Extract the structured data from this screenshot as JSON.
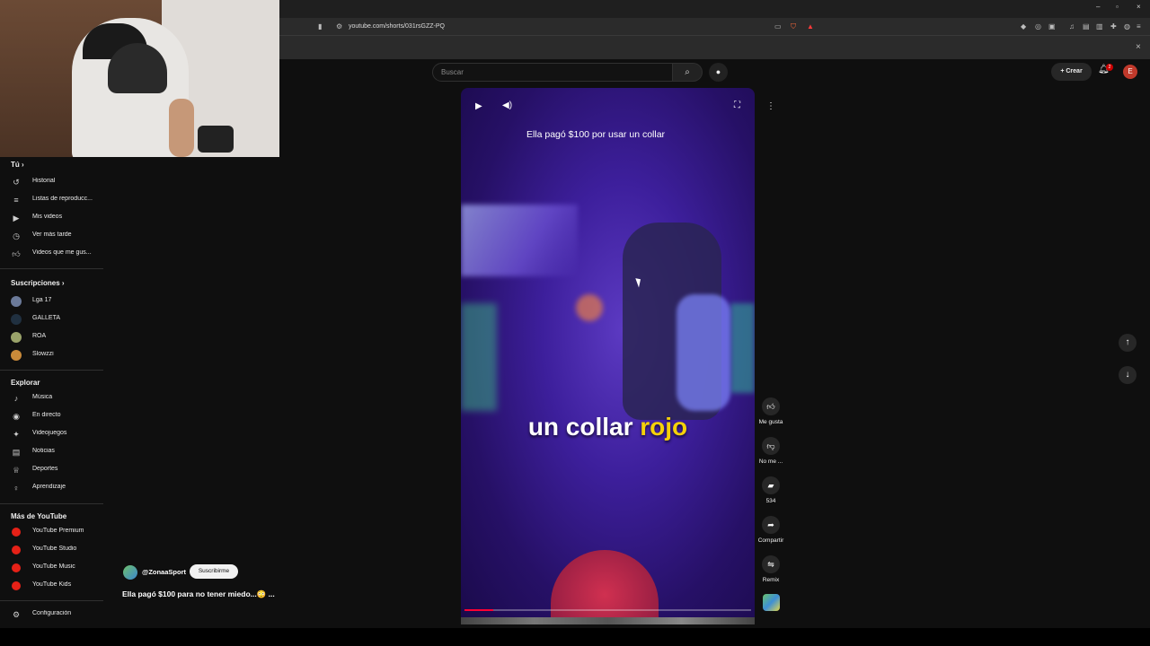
{
  "browser": {
    "url": "youtube.com/shorts/031rsGZZ-PQ",
    "close_panel": "×",
    "win_min": "–",
    "win_max": "▫",
    "win_close": "×"
  },
  "header": {
    "search_placeholder": "Buscar",
    "create_label": "Crear",
    "notif_count": "2",
    "avatar_letter": "E"
  },
  "sidebar": {
    "you": {
      "title": "Tú",
      "items": [
        {
          "label": "Historial",
          "icon": "history-icon"
        },
        {
          "label": "Listas de reproducc...",
          "icon": "playlist-icon"
        },
        {
          "label": "Mis videos",
          "icon": "my-videos-icon"
        },
        {
          "label": "Ver más tarde",
          "icon": "watch-later-icon"
        },
        {
          "label": "Videos que me gus...",
          "icon": "liked-videos-icon"
        }
      ]
    },
    "subs": {
      "title": "Suscripciones",
      "items": [
        {
          "label": "Lga 17",
          "color": "#6b7a99"
        },
        {
          "label": "GALLETA",
          "color": "#203040"
        },
        {
          "label": "ROA",
          "color": "#9aa36a"
        },
        {
          "label": "Slowzzi",
          "color": "#c98a3a"
        }
      ]
    },
    "explore": {
      "title": "Explorar",
      "items": [
        {
          "label": "Música",
          "icon": "music-icon"
        },
        {
          "label": "En directo",
          "icon": "live-icon"
        },
        {
          "label": "Videojuegos",
          "icon": "gaming-icon"
        },
        {
          "label": "Noticias",
          "icon": "news-icon"
        },
        {
          "label": "Deportes",
          "icon": "sports-icon"
        },
        {
          "label": "Aprendizaje",
          "icon": "learning-icon"
        }
      ]
    },
    "more": {
      "title": "Más de YouTube",
      "items": [
        {
          "label": "YouTube Premium"
        },
        {
          "label": "YouTube Studio"
        },
        {
          "label": "YouTube Music"
        },
        {
          "label": "YouTube Kids"
        }
      ]
    },
    "settings": "Configuración"
  },
  "short": {
    "overlay_title": "Ella pagó $100 por usar un collar",
    "caption_white": "un collar ",
    "caption_yellow": "rojo",
    "progress": 0.1,
    "channel": "@ZonaaSport",
    "subscribe": "Suscribirme",
    "description": "Ella pagó $100 para no tener miedo...😳 ..."
  },
  "actions": {
    "like": "Me gusta",
    "dislike": "No me ...",
    "comments": "534",
    "share": "Compartir",
    "remix": "Remix"
  },
  "colors": {
    "accent": "#ff0033",
    "caption_highlight": "#f5d10a"
  }
}
